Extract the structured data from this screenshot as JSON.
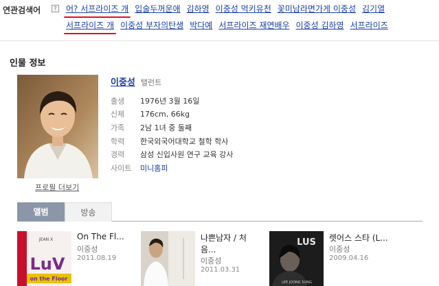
{
  "related": {
    "label": "연관검색어",
    "help_glyph": "?",
    "row1": [
      "어? 서프라이즈 개",
      "입술두꺼운애",
      "김하영",
      "이중성 먹키유천",
      "꽃미남라면가게 이중성",
      "김기열"
    ],
    "row2": [
      "서프라이즈 개",
      "이중성 부자의탄생",
      "박다예",
      "서프라이즈 재연배우",
      "이중성 김하영",
      "서프라이즈"
    ]
  },
  "person": {
    "section_title": "인물 정보",
    "name": "이중성",
    "job": "탤런트",
    "profile_more": "프로필 더보기",
    "rows": [
      {
        "key": "출생",
        "value": "1976년 3월 16일"
      },
      {
        "key": "신체",
        "value": "176cm, 66kg"
      },
      {
        "key": "가족",
        "value": "2남 1녀 중 둘째"
      },
      {
        "key": "학력",
        "value": "한국외국어대학교 철학 학사"
      },
      {
        "key": "경력",
        "value": "삼성 신입사원 연구 교육 강사"
      },
      {
        "key": "사이트",
        "value": "미니홈피"
      }
    ]
  },
  "tabs": {
    "album": "앨범",
    "broadcast": "방송"
  },
  "albums": [
    {
      "title": "On The Fl...",
      "artist": "이중성",
      "date": "2011.08.19",
      "cover_text": "LuV",
      "cover_sub": "on the Floor",
      "cover_brand": "JEAN X"
    },
    {
      "title": "나쁜남자 / 처",
      "title2": "음...",
      "artist": "이중성",
      "date": "2011.03.31"
    },
    {
      "title": "렛어스 스타 (L...",
      "artist": "이중성",
      "date": "2009.04.16",
      "cover_text": "LUS",
      "cover_sub": "LEE JOONG SUNG"
    }
  ],
  "colors": {
    "link": "#1a40a8",
    "highlight_underline": "#e0101c",
    "tab_active": "#8b97a8"
  }
}
